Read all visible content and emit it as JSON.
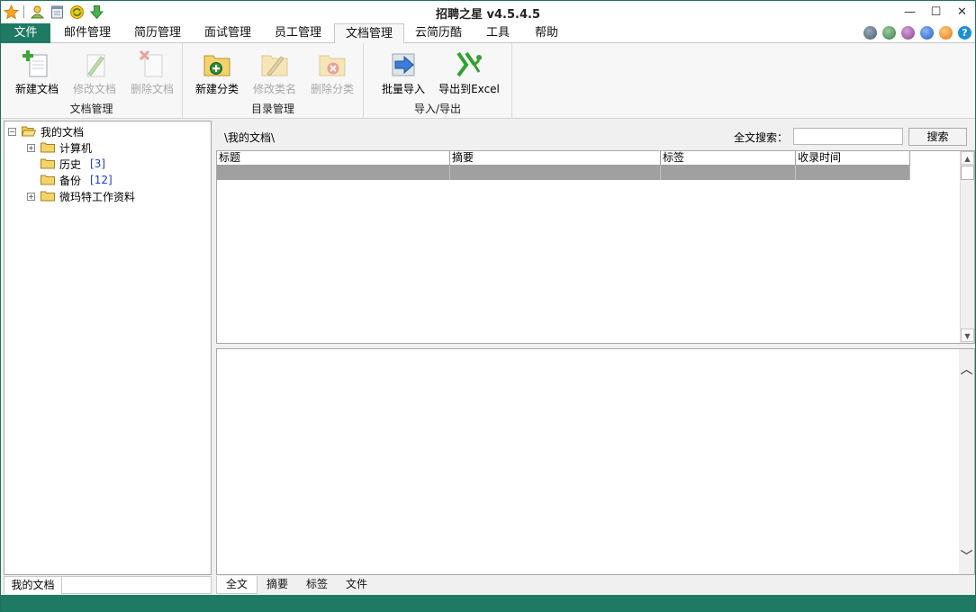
{
  "window": {
    "title": "招聘之星 v4.5.4.5",
    "controls": [
      "—",
      "☐",
      "✕"
    ]
  },
  "quick_access": [
    "star-icon",
    "user-icon",
    "calendar-icon",
    "refresh-icon",
    "download-icon"
  ],
  "tabs": [
    {
      "label": "文件"
    },
    {
      "label": "邮件管理"
    },
    {
      "label": "简历管理"
    },
    {
      "label": "面试管理"
    },
    {
      "label": "员工管理"
    },
    {
      "label": "文档管理"
    },
    {
      "label": "云简历酷"
    },
    {
      "label": "工具"
    },
    {
      "label": "帮助"
    }
  ],
  "active_tab": "文档管理",
  "ribbon": {
    "groups": [
      {
        "label": "文档管理",
        "buttons": [
          {
            "label": "新建文档",
            "enabled": true,
            "icon": "new-document-icon"
          },
          {
            "label": "修改文档",
            "enabled": false,
            "icon": "edit-document-icon"
          },
          {
            "label": "删除文档",
            "enabled": false,
            "icon": "delete-document-icon"
          }
        ]
      },
      {
        "label": "目录管理",
        "buttons": [
          {
            "label": "新建分类",
            "enabled": true,
            "icon": "new-folder-icon"
          },
          {
            "label": "修改类名",
            "enabled": false,
            "icon": "rename-folder-icon"
          },
          {
            "label": "删除分类",
            "enabled": false,
            "icon": "delete-folder-icon"
          }
        ]
      },
      {
        "label": "导入/导出",
        "buttons": [
          {
            "label": "批量导入",
            "enabled": true,
            "icon": "import-arrow-icon"
          },
          {
            "label": "导出到Excel",
            "enabled": true,
            "icon": "excel-export-icon"
          }
        ]
      }
    ]
  },
  "tree": {
    "root": "我的文档",
    "children": [
      {
        "label": "计算机",
        "expandable": true,
        "count": ""
      },
      {
        "label": "历史",
        "expandable": false,
        "count": "[3]"
      },
      {
        "label": "备份",
        "expandable": false,
        "count": "[12]"
      },
      {
        "label": "微玛特工作资料",
        "expandable": true,
        "count": ""
      }
    ]
  },
  "left_tab": "我的文档",
  "path": "\\我的文档\\",
  "search": {
    "label": "全文搜索：",
    "value": "",
    "button": "搜索"
  },
  "table": {
    "columns": [
      "标题",
      "摘要",
      "标签",
      "收录时间"
    ],
    "rows": []
  },
  "bottom_tabs": [
    "全文",
    "摘要",
    "标签",
    "文件"
  ],
  "colors": {
    "accent": "#1f7a64"
  }
}
